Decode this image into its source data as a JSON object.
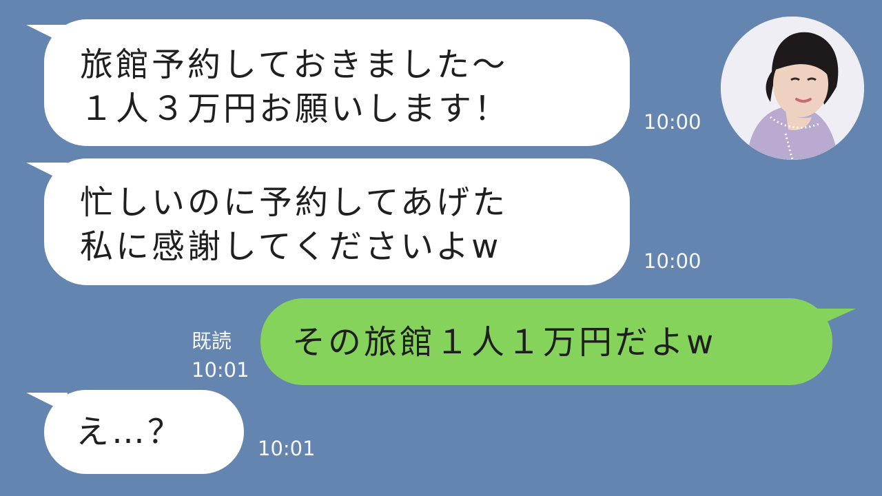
{
  "chat": {
    "messages": [
      {
        "text": "旅館予約しておきました〜\n１人３万円お願いします！",
        "time": "10:00"
      },
      {
        "text": "忙しいのに予約してあげた\n私に感謝してくださいよw",
        "time": "10:00"
      },
      {
        "text": "その旅館１人１万円だよw",
        "read": "既読",
        "time": "10:01"
      },
      {
        "text": "え…？",
        "time": "10:01"
      }
    ],
    "avatar_icon": "woman-avatar-icon",
    "colors": {
      "background": "#6585b1",
      "incoming_bubble": "#ffffff",
      "outgoing_bubble": "#85d35b",
      "timestamp": "#ffffff"
    }
  }
}
